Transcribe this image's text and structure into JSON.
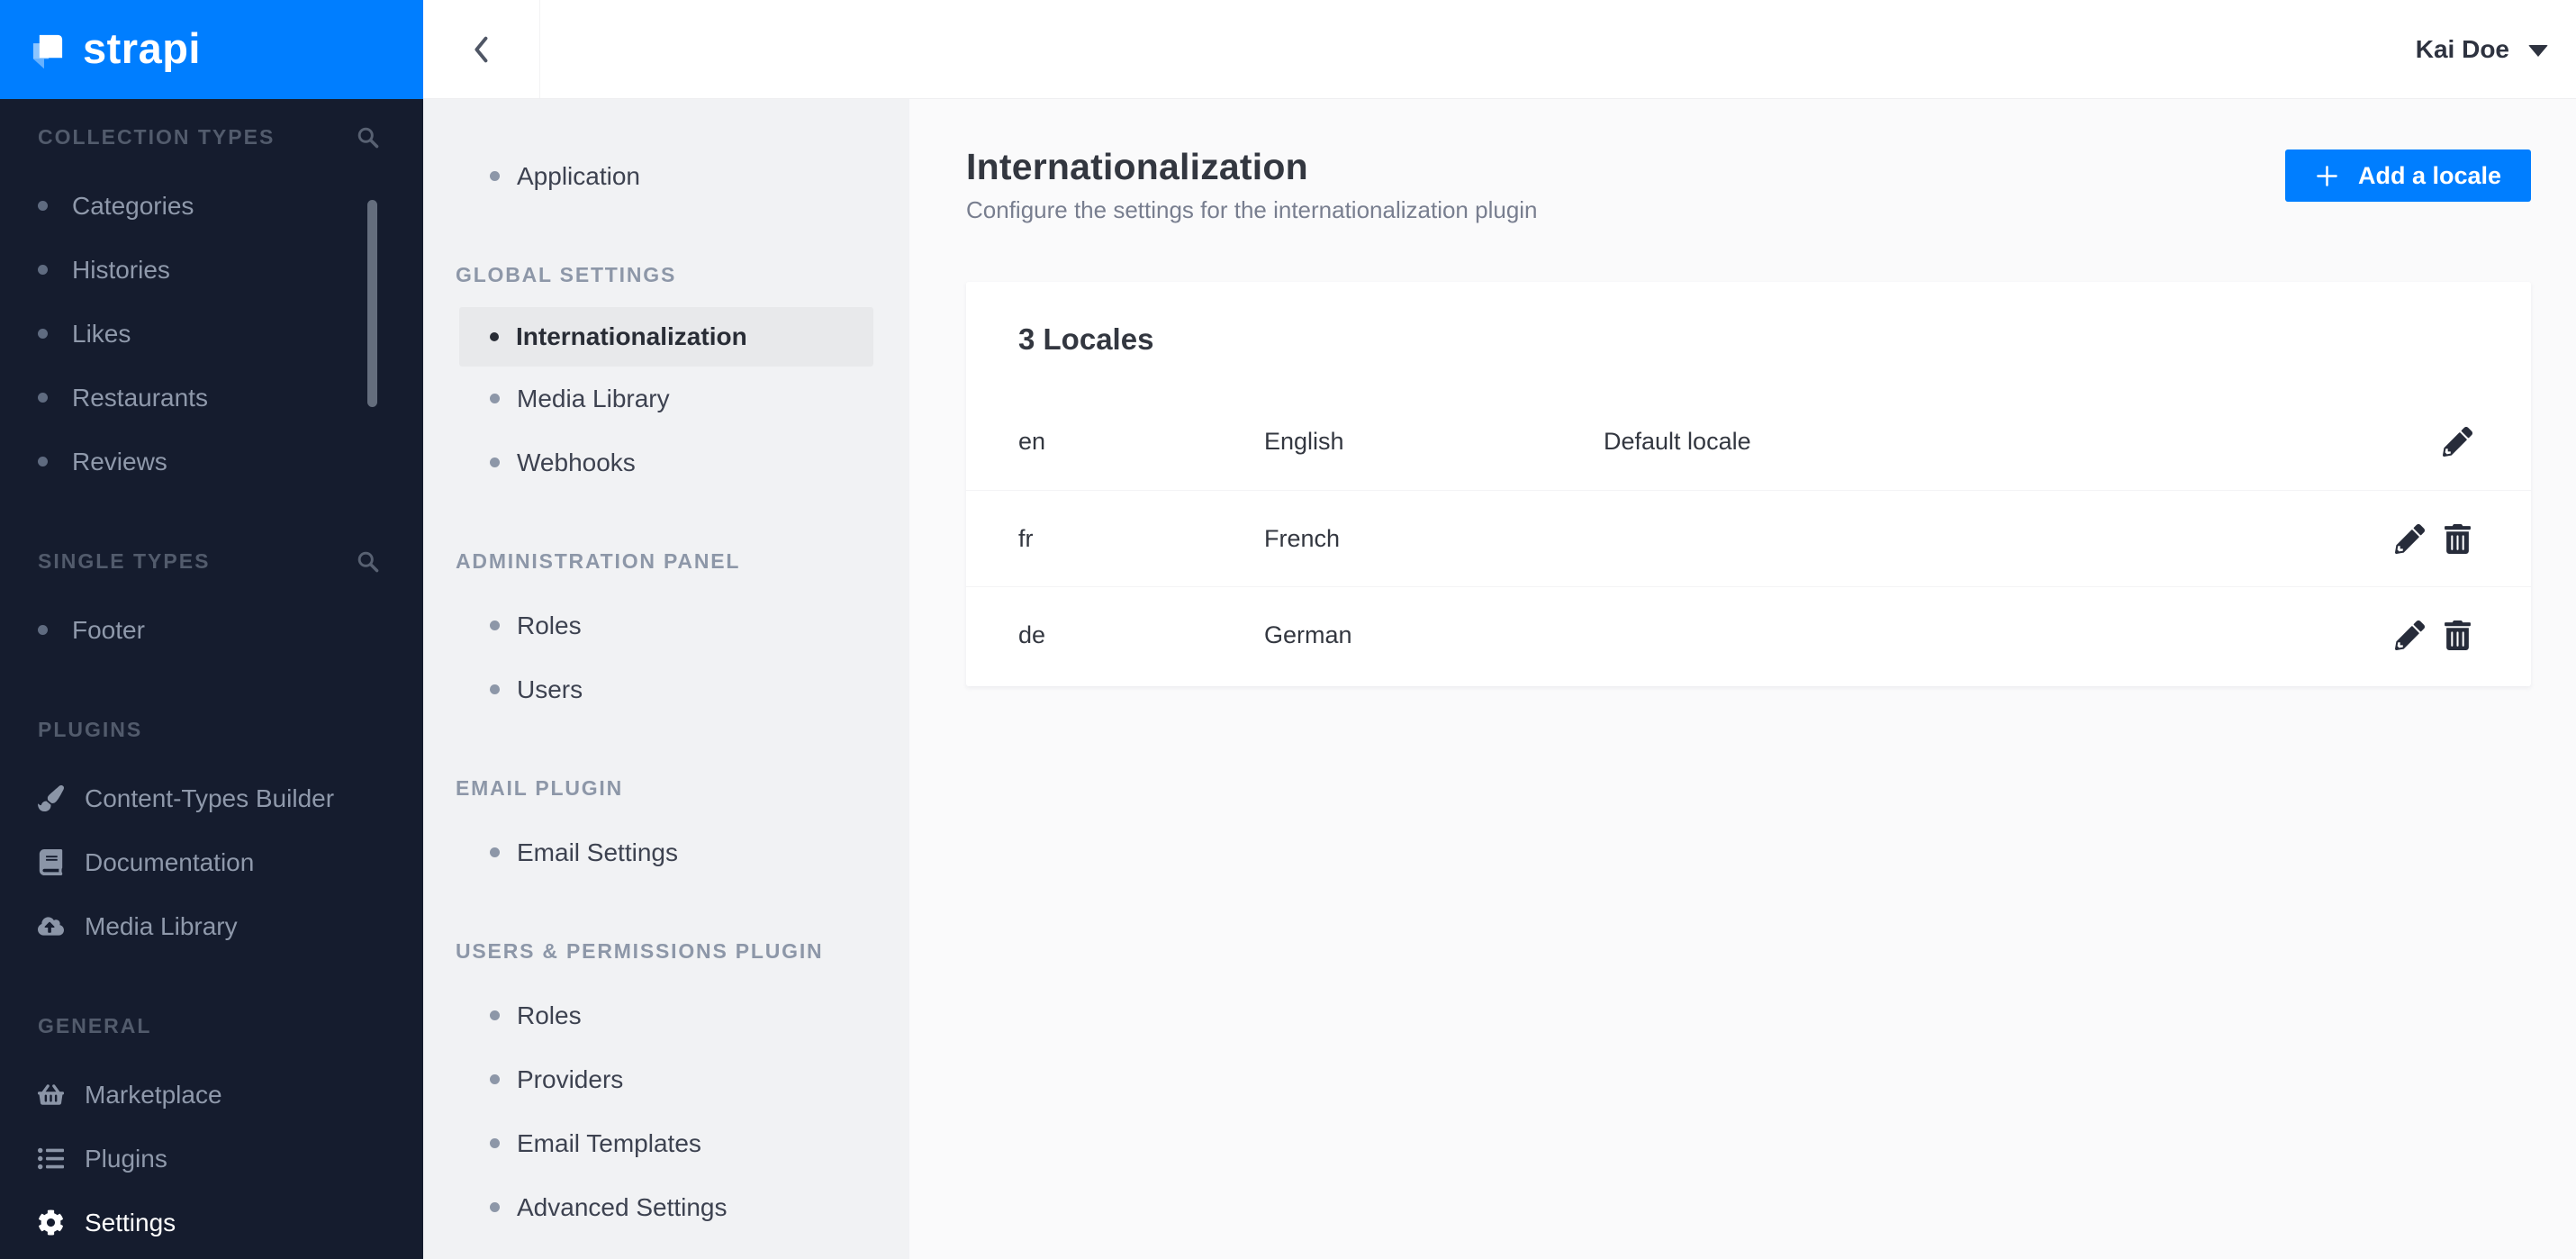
{
  "brand": {
    "logo_text": "strapi"
  },
  "sidebar": {
    "sections": [
      {
        "title": "COLLECTION TYPES",
        "has_search": true,
        "items": [
          {
            "label": "Categories"
          },
          {
            "label": "Histories"
          },
          {
            "label": "Likes"
          },
          {
            "label": "Restaurants"
          },
          {
            "label": "Reviews"
          }
        ]
      },
      {
        "title": "SINGLE TYPES",
        "has_search": true,
        "items": [
          {
            "label": "Footer"
          }
        ]
      },
      {
        "title": "PLUGINS",
        "has_search": false,
        "items": [
          {
            "label": "Content-Types Builder",
            "icon": "paint-brush-icon"
          },
          {
            "label": "Documentation",
            "icon": "book-icon"
          },
          {
            "label": "Media Library",
            "icon": "cloud-upload-icon"
          }
        ]
      },
      {
        "title": "GENERAL",
        "has_search": false,
        "items": [
          {
            "label": "Marketplace",
            "icon": "basket-icon"
          },
          {
            "label": "Plugins",
            "icon": "list-icon"
          },
          {
            "label": "Settings",
            "icon": "gear-icon",
            "active": true
          }
        ]
      }
    ]
  },
  "topbar": {
    "user_name": "Kai Doe"
  },
  "settings_nav": {
    "sections": [
      {
        "title": "",
        "items": [
          {
            "label": "Application"
          }
        ]
      },
      {
        "title": "GLOBAL SETTINGS",
        "items": [
          {
            "label": "Internationalization",
            "active": true
          },
          {
            "label": "Media Library"
          },
          {
            "label": "Webhooks"
          }
        ]
      },
      {
        "title": "ADMINISTRATION PANEL",
        "items": [
          {
            "label": "Roles"
          },
          {
            "label": "Users"
          }
        ]
      },
      {
        "title": "EMAIL PLUGIN",
        "items": [
          {
            "label": "Email Settings"
          }
        ]
      },
      {
        "title": "USERS & PERMISSIONS PLUGIN",
        "items": [
          {
            "label": "Roles"
          },
          {
            "label": "Providers"
          },
          {
            "label": "Email Templates"
          },
          {
            "label": "Advanced Settings"
          }
        ]
      }
    ]
  },
  "main": {
    "title": "Internationalization",
    "subtitle": "Configure the settings for the internationalization plugin",
    "add_locale_button": "Add a locale",
    "locales_card": {
      "heading": "3 Locales",
      "rows": [
        {
          "code": "en",
          "name": "English",
          "info": "Default locale",
          "can_delete": false
        },
        {
          "code": "fr",
          "name": "French",
          "info": "",
          "can_delete": true
        },
        {
          "code": "de",
          "name": "German",
          "info": "",
          "can_delete": true
        }
      ]
    }
  },
  "colors": {
    "accent": "#007eff",
    "sidebar_bg": "#151c2e",
    "subnav_bg": "#f1f2f4",
    "subnav_active_bg": "#e8e9eb",
    "content_bg": "#fafafb",
    "text_dark": "#333740",
    "text_muted": "#787e8f"
  }
}
